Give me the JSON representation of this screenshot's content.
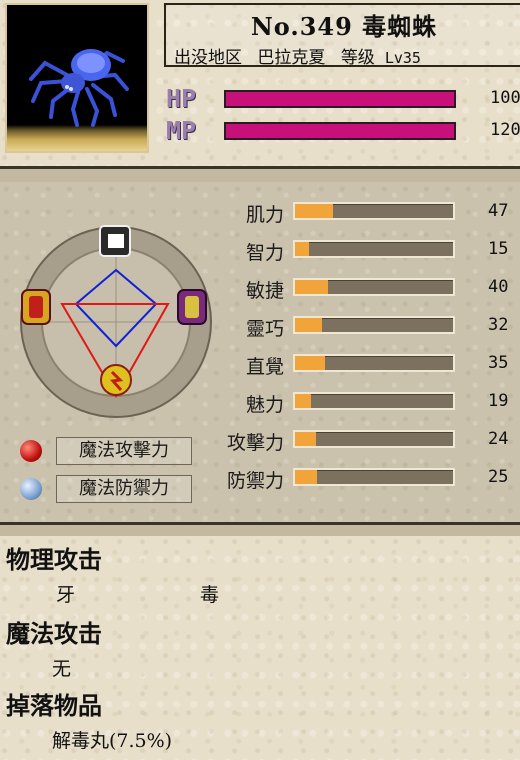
{
  "monster": {
    "name_line": "No.349 毒蜘蛛",
    "region_label": "出没地区",
    "region": "巴拉克夏",
    "level_label": "等级",
    "level": "Lv35",
    "hp_label": "HP",
    "hp_value": "100",
    "mp_label": "MP",
    "mp_value": "120",
    "hp_fill": 1.0,
    "mp_fill": 1.0
  },
  "stats": [
    {
      "label": "肌力",
      "value": "47",
      "fill": 0.24
    },
    {
      "label": "智力",
      "value": "15",
      "fill": 0.09
    },
    {
      "label": "敏捷",
      "value": "40",
      "fill": 0.21
    },
    {
      "label": "靈巧",
      "value": "32",
      "fill": 0.17
    },
    {
      "label": "直覺",
      "value": "35",
      "fill": 0.19
    },
    {
      "label": "魅力",
      "value": "19",
      "fill": 0.1
    },
    {
      "label": "攻擊力",
      "value": "24",
      "fill": 0.13
    },
    {
      "label": "防禦力",
      "value": "25",
      "fill": 0.14
    }
  ],
  "magic": {
    "attack_label": "魔法攻擊力",
    "defense_label": "魔法防禦力"
  },
  "colors": {
    "hp_bar": "#c8107a",
    "stat_fill": "#f0a43a",
    "stat_track": "#7b715e"
  },
  "info": {
    "physical_title": "物理攻击",
    "physical_items": [
      "牙",
      "毒"
    ],
    "magic_title": "魔法攻击",
    "magic_items": [
      "无"
    ],
    "drop_title": "掉落物品",
    "drop_items": [
      "解毒丸(7.5%)"
    ]
  }
}
